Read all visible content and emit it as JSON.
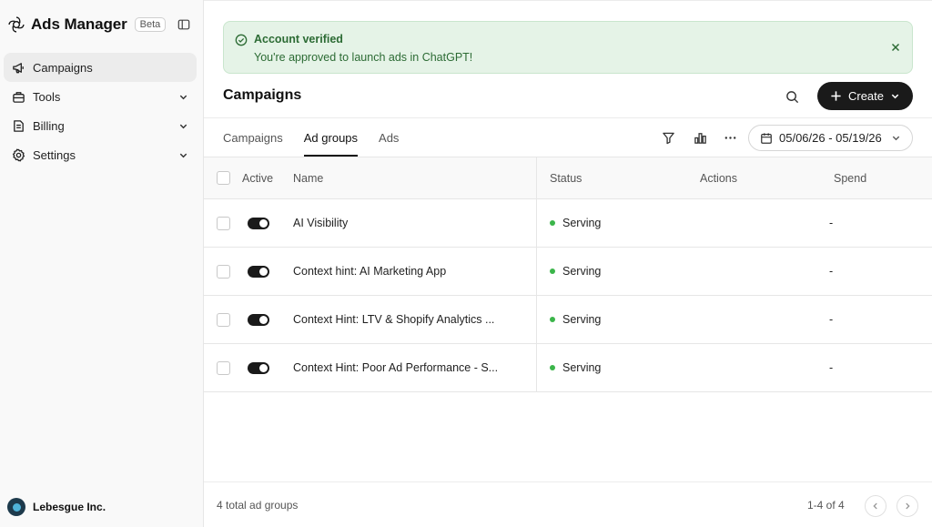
{
  "sidebar": {
    "app_title": "Ads Manager",
    "badge": "Beta",
    "items": [
      {
        "label": "Campaigns",
        "icon": "megaphone-icon",
        "active": true
      },
      {
        "label": "Tools",
        "icon": "toolbox-icon"
      },
      {
        "label": "Billing",
        "icon": "receipt-icon"
      },
      {
        "label": "Settings",
        "icon": "gear-icon"
      }
    ],
    "org_name": "Lebesgue Inc."
  },
  "banner": {
    "title": "Account verified",
    "message": "You're approved to launch ads in ChatGPT!",
    "color": "#2c6b34"
  },
  "header": {
    "title": "Campaigns",
    "create_label": "Create"
  },
  "tabs": [
    "Campaigns",
    "Ad groups",
    "Ads"
  ],
  "active_tab": "Ad groups",
  "date_range": "05/06/26 - 05/19/26",
  "table": {
    "columns": [
      "Active",
      "Name",
      "Status",
      "Actions",
      "Spend"
    ],
    "rows": [
      {
        "name": "AI Visibility",
        "status": "Serving",
        "spend": "-"
      },
      {
        "name": "Context hint: AI Marketing App",
        "status": "Serving",
        "spend": "-"
      },
      {
        "name": "Context Hint: LTV & Shopify Analytics ...",
        "status": "Serving",
        "spend": "-"
      },
      {
        "name": "Context Hint: Poor Ad Performance - S...",
        "status": "Serving",
        "spend": "-"
      }
    ]
  },
  "footer": {
    "total": "4 total ad groups",
    "range": "1-4 of 4"
  },
  "colors": {
    "serving": "#3bb54a",
    "banner_bg": "#e5f3e7",
    "primary": "#1a1a1a"
  }
}
